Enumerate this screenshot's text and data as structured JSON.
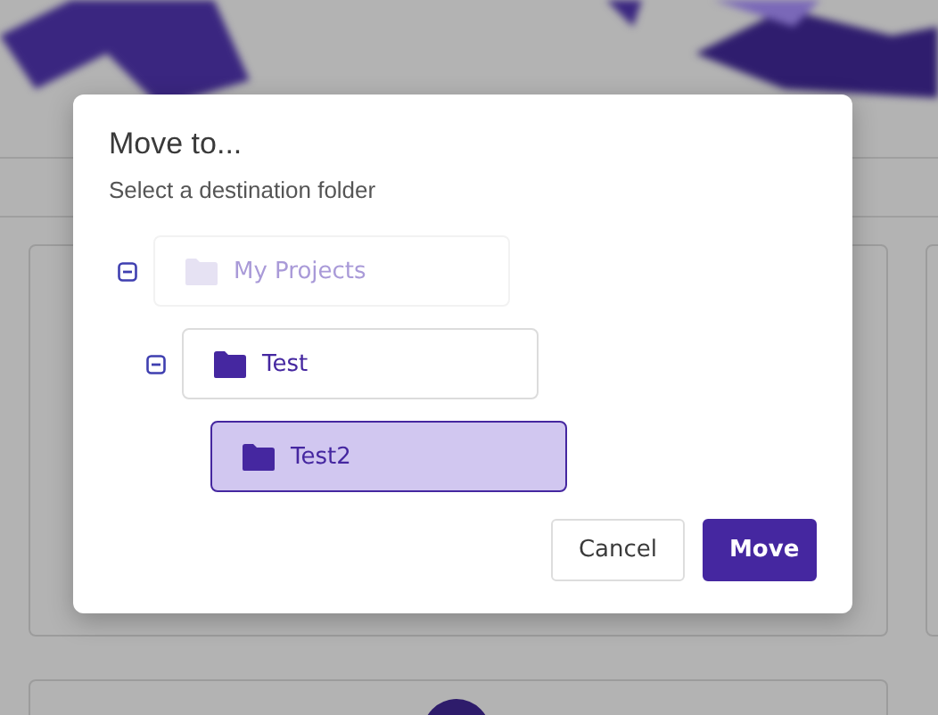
{
  "dialog": {
    "title": "Move to...",
    "subtitle": "Select a destination folder",
    "tree": [
      {
        "label": "My Projects",
        "expanded": true,
        "disabled": true,
        "selected": false,
        "children": [
          {
            "label": "Test",
            "expanded": true,
            "disabled": false,
            "selected": false,
            "children": [
              {
                "label": "Test2",
                "disabled": false,
                "selected": true
              }
            ]
          }
        ]
      }
    ],
    "buttons": [
      {
        "label": "Cancel",
        "kind": "secondary"
      },
      {
        "label": "Move",
        "kind": "primary"
      }
    ]
  }
}
